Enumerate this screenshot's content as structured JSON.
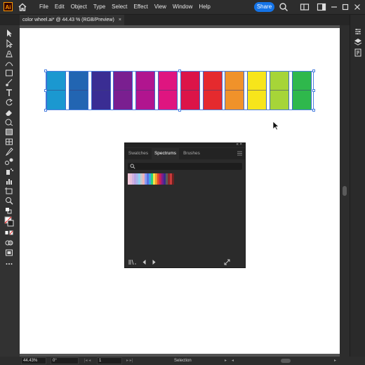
{
  "app": {
    "logo_text": "Ai"
  },
  "menu": [
    "File",
    "Edit",
    "Object",
    "Type",
    "Select",
    "Effect",
    "View",
    "Window",
    "Help"
  ],
  "share_label": "Share",
  "document_tab": {
    "title": "color wheel.ai* @ 44.43 % (RGB/Preview)",
    "close": "×"
  },
  "swatches": [
    {
      "color": "#1b98d0"
    },
    {
      "color": "#2265b2"
    },
    {
      "color": "#3a2d93"
    },
    {
      "color": "#7a1f90"
    },
    {
      "color": "#b1158f"
    },
    {
      "color": "#df1580"
    },
    {
      "color": "#dc1448"
    },
    {
      "color": "#e52a2e"
    },
    {
      "color": "#f0922a"
    },
    {
      "color": "#f7e51b"
    },
    {
      "color": "#a6d538"
    },
    {
      "color": "#2fb84c"
    }
  ],
  "panel": {
    "tabs": [
      "Swatches",
      "Spectrums",
      "Brushes"
    ],
    "active_tab": "Spectrums",
    "controls": "«  ×",
    "spectrum_colors": [
      "#f3c9d9",
      "#e7bfd8",
      "#cfb1e0",
      "#b9a4e4",
      "#a6b7ea",
      "#8fd3ee",
      "#c8c8c8",
      "#f0b1b7",
      "#8a9cf0",
      "#5a6fe2",
      "#3aa6e6",
      "#2ccf7a",
      "#f5e14a",
      "#f09a2e",
      "#e5452f",
      "#c11e60",
      "#7a1e8c",
      "#3a2b8e",
      "#5b5b5b",
      "#8a2b2b",
      "#c83a3a",
      "#6b2020"
    ]
  },
  "status": {
    "zoom": "44.43%",
    "rotate": "0°",
    "artboard": "1",
    "mode": "Selection"
  }
}
